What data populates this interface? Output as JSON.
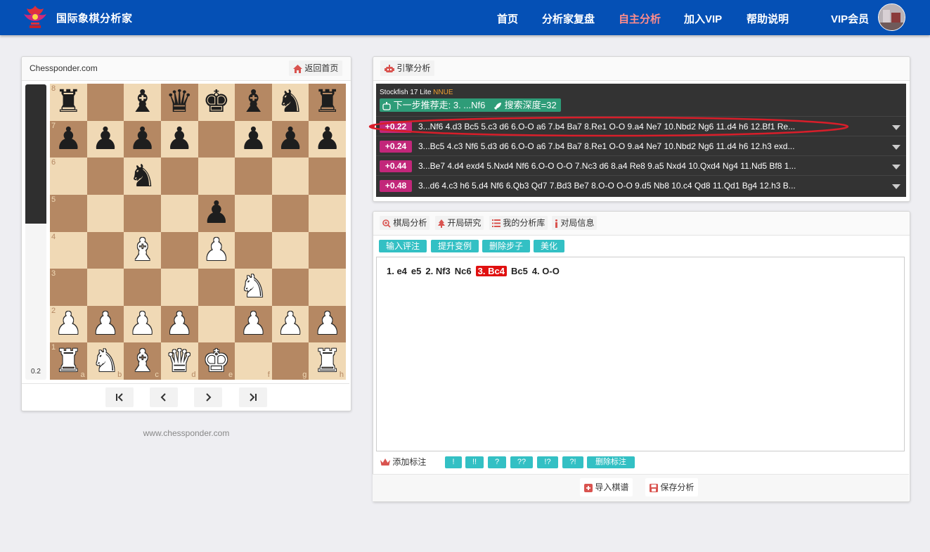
{
  "header": {
    "site_title": "国际象棋分析家",
    "nav": [
      {
        "label": "首页",
        "active": false
      },
      {
        "label": "分析家复盘",
        "active": false
      },
      {
        "label": "自主分析",
        "active": true
      },
      {
        "label": "加入VIP",
        "active": false
      },
      {
        "label": "帮助说明",
        "active": false
      },
      {
        "label": "VIP会员",
        "active": false
      }
    ],
    "accent_color": "#0550b5",
    "active_color": "#ff8c8c"
  },
  "board_panel": {
    "site_label": "Chessponder.com",
    "home_button": "返回首页",
    "eval_value": "0.2",
    "white_eval_fraction": 0.53,
    "ranks": [
      "8",
      "7",
      "6",
      "5",
      "4",
      "3",
      "2",
      "1"
    ],
    "files": [
      "a",
      "b",
      "c",
      "d",
      "e",
      "f",
      "g",
      "h"
    ],
    "position": [
      [
        "r",
        "",
        "b",
        "q",
        "k",
        "b",
        "n",
        "r"
      ],
      [
        "p",
        "p",
        "p",
        "p",
        "",
        "p",
        "p",
        "p"
      ],
      [
        "",
        "",
        "n",
        "",
        "",
        "",
        "",
        ""
      ],
      [
        "",
        "",
        "",
        "",
        "p",
        "",
        "",
        ""
      ],
      [
        "",
        "",
        "B",
        "",
        "P",
        "",
        "",
        ""
      ],
      [
        "",
        "",
        "",
        "",
        "",
        "N",
        "",
        ""
      ],
      [
        "P",
        "P",
        "P",
        "P",
        "",
        "P",
        "P",
        "P"
      ],
      [
        "R",
        "N",
        "B",
        "Q",
        "K",
        "",
        "",
        "R"
      ]
    ],
    "nav_buttons": [
      "first-move-icon",
      "prev-move-icon",
      "next-move-icon",
      "last-move-icon"
    ],
    "footer_url": "www.chessponder.com"
  },
  "engine_panel": {
    "title": "引擎分析",
    "engine_name": "Stockfish 17 Lite",
    "engine_tag": "NNUE",
    "recommend": "下一步推荐走: 3. ...Nf6",
    "depth": "搜索深度=32",
    "lines": [
      {
        "score": "+0.22",
        "pv": "3...Nf6 4.d3 Bc5 5.c3 d6 6.O-O a6 7.b4 Ba7 8.Re1 O-O 9.a4 Ne7 10.Nbd2 Ng6 11.d4 h6 12.Bf1 Re..."
      },
      {
        "score": "+0.24",
        "pv": "3...Bc5 4.c3 Nf6 5.d3 d6 6.O-O a6 7.b4 Ba7 8.Re1 O-O 9.a4 Ne7 10.Nbd2 Ng6 11.d4 h6 12.h3 exd..."
      },
      {
        "score": "+0.44",
        "pv": "3...Be7 4.d4 exd4 5.Nxd4 Nf6 6.O-O O-O 7.Nc3 d6 8.a4 Re8 9.a5 Nxd4 10.Qxd4 Ng4 11.Nd5 Bf8 1..."
      },
      {
        "score": "+0.48",
        "pv": "3...d6 4.c3 h6 5.d4 Nf6 6.Qb3 Qd7 7.Bd3 Be7 8.O-O O-O 9.d5 Nb8 10.c4 Qd8 11.Qd1 Bg4 12.h3 B..."
      }
    ],
    "score_color": "#c2277a",
    "highlight_color": "#d81e2a"
  },
  "analysis_panel": {
    "tabs": [
      "棋局分析",
      "开局研究",
      "我的分析库",
      "对局信息"
    ],
    "actions": [
      "输入评注",
      "提升变例",
      "删除步子",
      "美化"
    ],
    "moves": [
      {
        "text": "1. e4",
        "current": false
      },
      {
        "text": "e5",
        "current": false
      },
      {
        "text": "2. Nf3",
        "current": false
      },
      {
        "text": "Nc6",
        "current": false
      },
      {
        "text": "3. Bc4",
        "current": true
      },
      {
        "text": "Bc5",
        "current": false
      },
      {
        "text": "4. O-O",
        "current": false
      }
    ],
    "annotate_label": "添加标注",
    "annotations": [
      "!",
      "!!",
      "?",
      "??",
      "!?",
      "?!",
      "删除标注"
    ],
    "import_button": "导入棋谱",
    "save_button": "保存分析",
    "button_color": "#33c0c4"
  }
}
